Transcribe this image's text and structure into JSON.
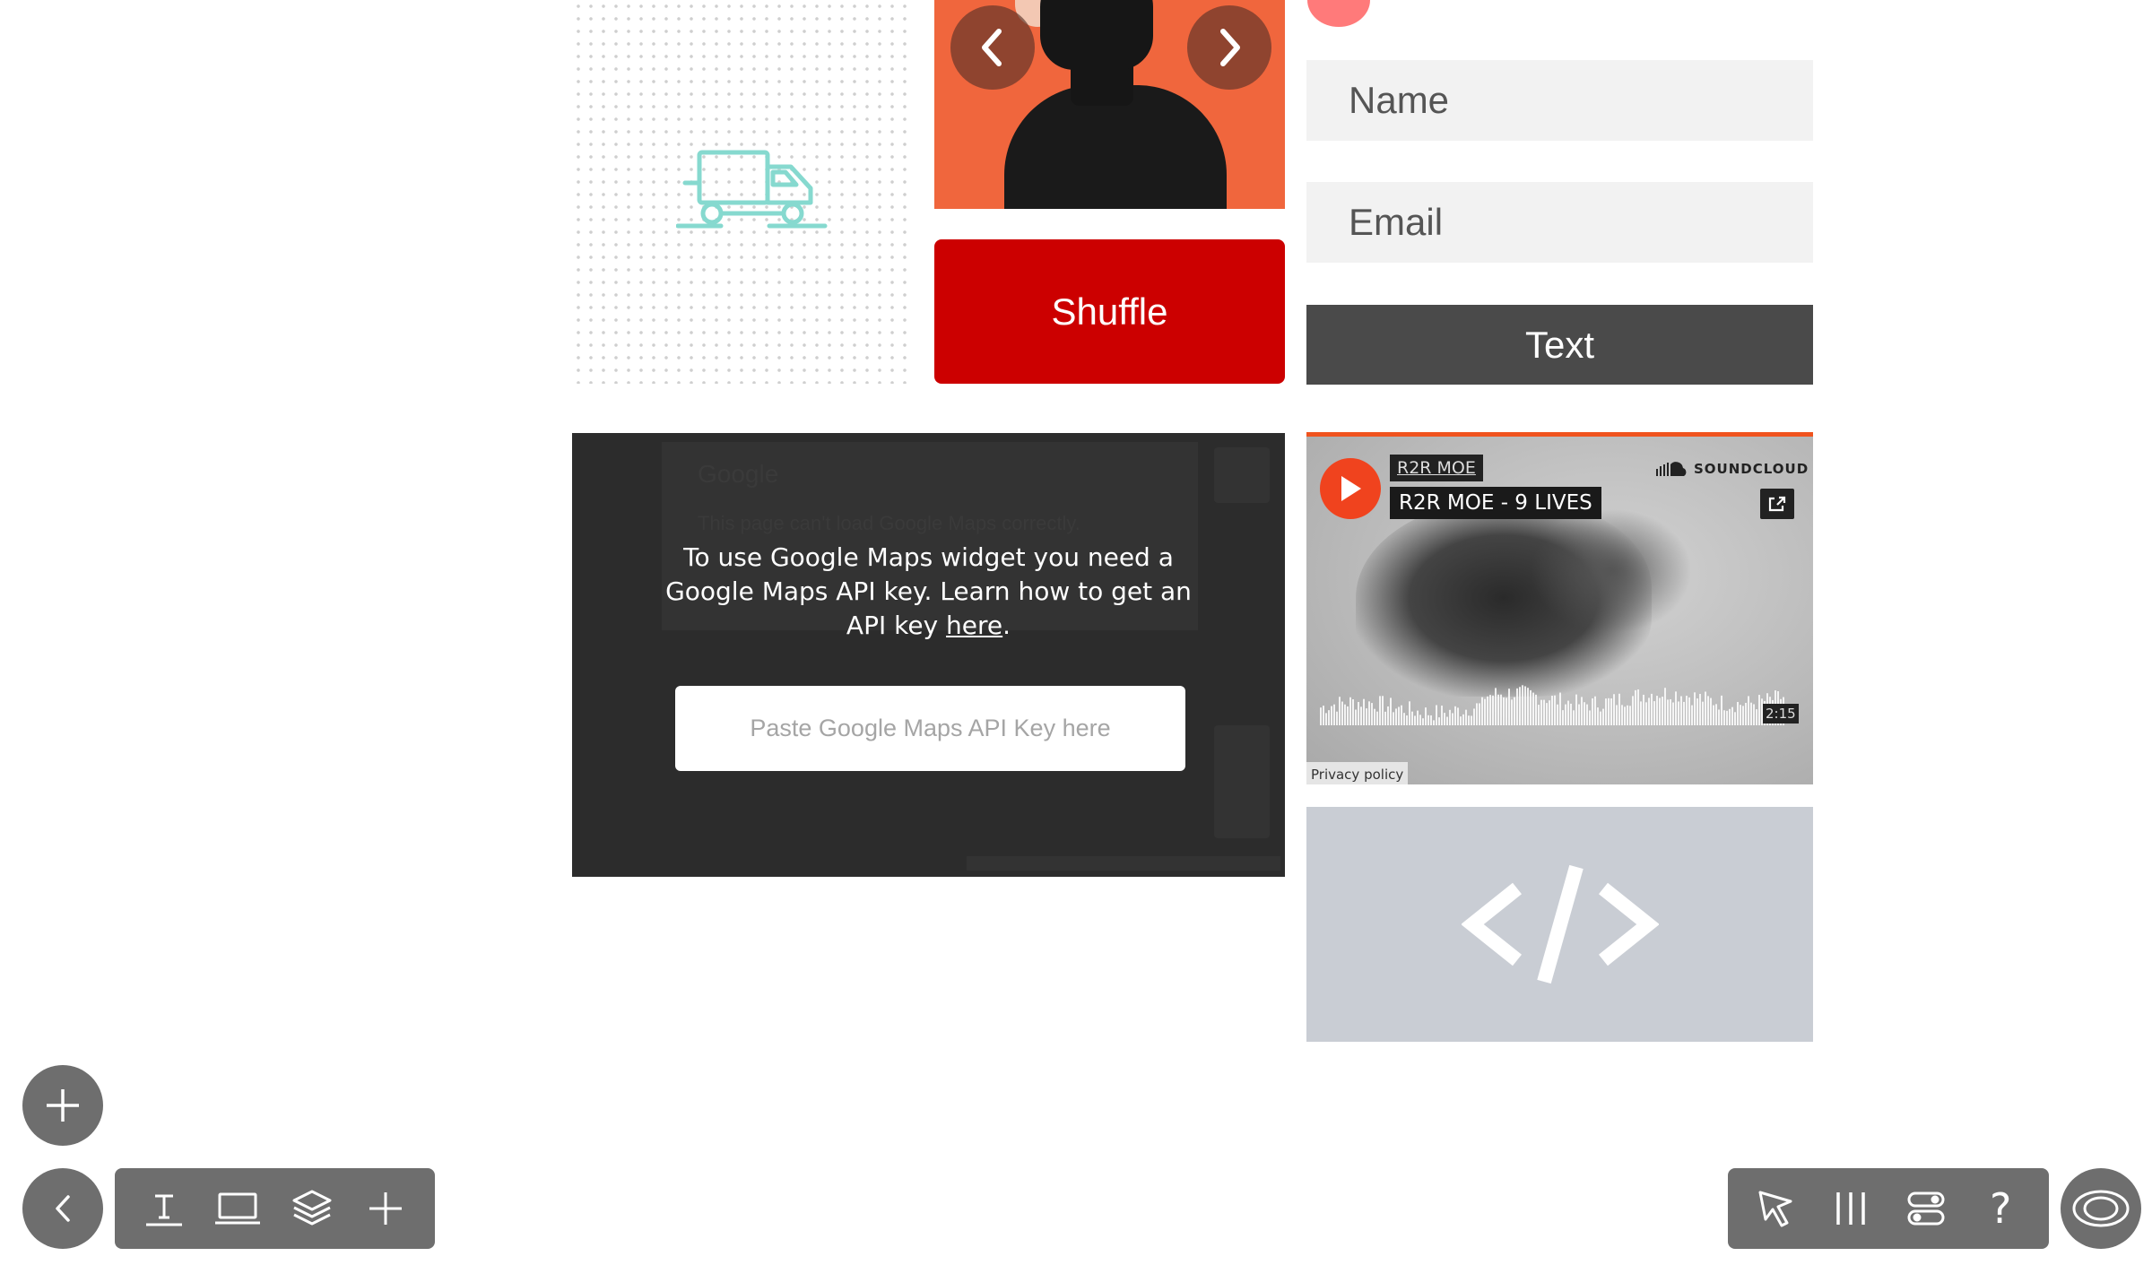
{
  "slider": {
    "prev_icon": "chevron-left-icon",
    "next_icon": "chevron-right-icon"
  },
  "shuffle": {
    "label": "Shuffle",
    "color": "#cc0000"
  },
  "form": {
    "name_placeholder": "Name",
    "email_placeholder": "Email",
    "submit_label": "Text"
  },
  "maps": {
    "ghost_title": "Google",
    "ghost_error": "This page can't load Google Maps correctly.",
    "message_before": "To use Google Maps widget you need a Google Maps API key. Learn how to get an API key ",
    "message_link": "here",
    "message_after": ".",
    "input_placeholder": "Paste Google Maps API Key here"
  },
  "soundcloud": {
    "user": "R2R MOE",
    "track": "R2R MOE - 9 LIVES",
    "brand": "SOUNDCLOUD",
    "duration": "2:15",
    "privacy": "Privacy policy",
    "accent": "#f0531e"
  },
  "embed": {
    "icon": "code-icon"
  },
  "toolbar_left": {
    "items": [
      "text-tool-icon",
      "device-icon",
      "layers-icon",
      "add-icon"
    ]
  },
  "toolbar_right": {
    "items": [
      "pointer-icon",
      "columns-icon",
      "toggles-icon",
      "help-icon"
    ],
    "help_label": "?"
  },
  "fab": {
    "icon": "plus-icon"
  },
  "preview": {
    "icon": "eye-icon"
  }
}
